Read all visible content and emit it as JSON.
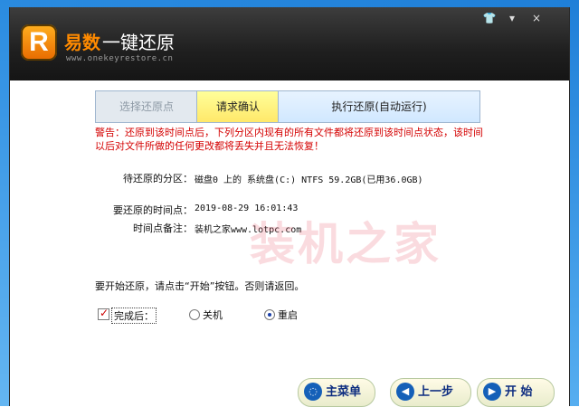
{
  "window": {
    "brand": "易数",
    "title": "一键还原",
    "url": "www.onekeyrestore.cn",
    "controls": [
      "👕",
      "▾",
      "×"
    ]
  },
  "steps": [
    "选择还原点",
    "请求确认",
    "执行还原(自动运行)"
  ],
  "warning": "警告：还原到该时间点后，下列分区内现有的所有文件都将还原到该时间点状态，该时间以后对文件所做的任何更改都将丢失并且无法恢复！",
  "info": {
    "partition_label": "待还原的分区：",
    "partition_value": "磁盘0 上的 系统盘(C:) NTFS 59.2GB(已用36.0GB)",
    "time_label": "要还原的时间点：",
    "time_value": "2019-08-29 16:01:43",
    "note_label": "时间点备注：",
    "note_value": "装机之家www.lotpc.com"
  },
  "watermark": "装机之家",
  "prompt": "要开始还原，请点击“开始”按钮。否则请返回。",
  "on_complete": {
    "label": "完成后：",
    "checked": true,
    "shutdown_label": "关机",
    "restart_label": "重启",
    "selected": "重启"
  },
  "buttons": {
    "main_menu": "主菜单",
    "previous": "上一步",
    "start": "开 始"
  },
  "colors": {
    "warning": "#d40000",
    "active_step": "#ffef7a",
    "accent": "#ff8a00"
  }
}
